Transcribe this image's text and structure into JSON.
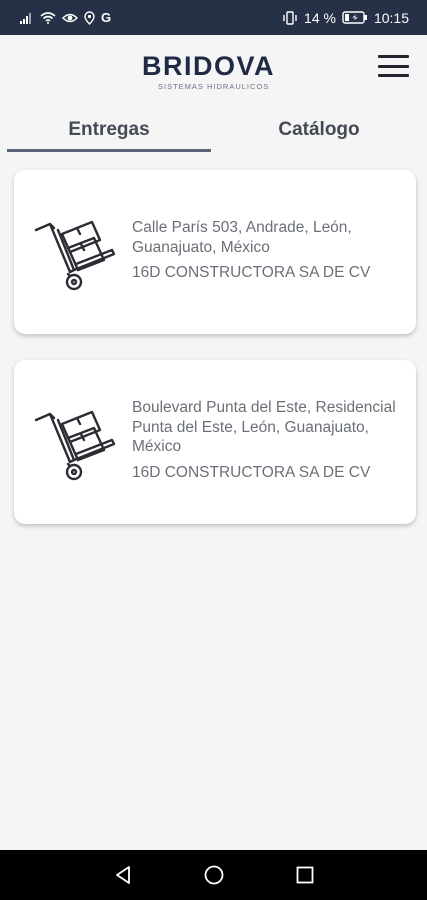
{
  "status_bar": {
    "battery_percent": "14 %",
    "time": "10:15",
    "carrier_icon": "G"
  },
  "header": {
    "logo_text": "BRIDOVA",
    "logo_subtitle": "SISTEMAS HIDRAULICOS"
  },
  "tabs": [
    {
      "label": "Entregas",
      "selected": true
    },
    {
      "label": "Catálogo",
      "selected": false
    }
  ],
  "deliveries": [
    {
      "address": "Calle París 503, Andrade, León, Guanajuato, México",
      "company": "16D CONSTRUCTORA SA DE CV",
      "icon": "hand-truck-boxes-icon"
    },
    {
      "address": "Boulevard Punta del Este, Residencial Punta del Este, León, Guanajuato, México",
      "company": "16D CONSTRUCTORA SA DE CV",
      "icon": "hand-truck-boxes-icon"
    }
  ],
  "colors": {
    "status_bar_bg": "#263046",
    "brand": "#1f2a44",
    "tab_indicator": "#5a6478",
    "background": "#f5f5f5"
  }
}
